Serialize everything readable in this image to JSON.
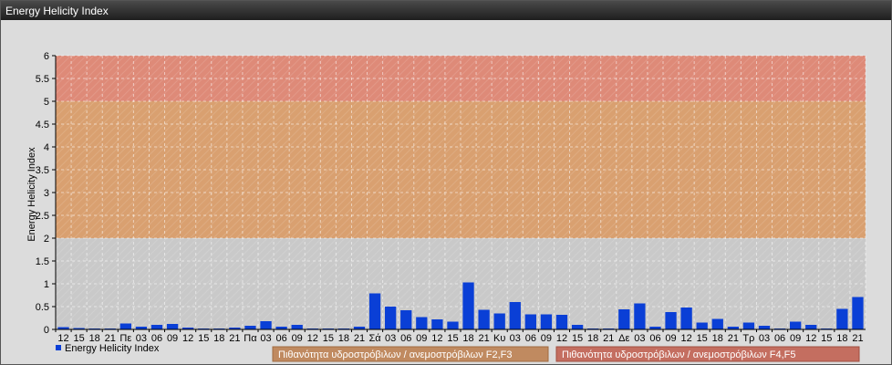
{
  "window": {
    "title": "Energy Helicity Index"
  },
  "chart_data": {
    "type": "bar",
    "ylabel": "Energy Helicity Index",
    "ylim": [
      0,
      6
    ],
    "yticks": [
      "0",
      "0.5",
      "1",
      "1.5",
      "2",
      "2.5",
      "3",
      "3.5",
      "4",
      "4.5",
      "5",
      "5.5",
      "6"
    ],
    "categories": [
      "12",
      "15",
      "18",
      "21",
      "Πε",
      "03",
      "06",
      "09",
      "12",
      "15",
      "18",
      "21",
      "Πα",
      "03",
      "06",
      "09",
      "12",
      "15",
      "18",
      "21",
      "Σά",
      "03",
      "06",
      "09",
      "12",
      "15",
      "18",
      "21",
      "Κυ",
      "03",
      "06",
      "09",
      "12",
      "15",
      "18",
      "21",
      "Δε",
      "03",
      "06",
      "09",
      "12",
      "15",
      "18",
      "21",
      "Τρ",
      "03",
      "06",
      "09",
      "12",
      "15",
      "18",
      "21"
    ],
    "series": [
      {
        "name": "Energy Helicity Index",
        "color": "#0a3fd6",
        "values": [
          0.05,
          0.03,
          0.02,
          0.02,
          0.13,
          0.06,
          0.1,
          0.12,
          0.04,
          0.02,
          0.02,
          0.04,
          0.08,
          0.18,
          0.06,
          0.1,
          0.02,
          0.02,
          0.02,
          0.06,
          0.79,
          0.5,
          0.42,
          0.27,
          0.22,
          0.17,
          1.03,
          0.43,
          0.35,
          0.6,
          0.33,
          0.33,
          0.32,
          0.1,
          0.02,
          0.02,
          0.44,
          0.57,
          0.06,
          0.38,
          0.48,
          0.15,
          0.23,
          0.06,
          0.15,
          0.08,
          0.02,
          0.17,
          0.1,
          0.02,
          0.45,
          0.71
        ]
      }
    ],
    "bands": [
      {
        "from": 0,
        "to": 2,
        "color": "#c9c9c9"
      },
      {
        "from": 2,
        "to": 5,
        "color": "#d9a070"
      },
      {
        "from": 5,
        "to": 6,
        "color": "#de8a78"
      }
    ],
    "grid": true,
    "legend": {
      "series_label": "Energy Helicity Index",
      "zone1": {
        "text": "Πιθανότητα υδροστρόβιλων / ανεμοστρόβιλων F2,F3",
        "color": "#c08a60"
      },
      "zone2": {
        "text": "Πιθανότητα υδροστρόβιλων / ανεμοστρόβιλων F4,F5",
        "color": "#c46e60"
      }
    }
  }
}
